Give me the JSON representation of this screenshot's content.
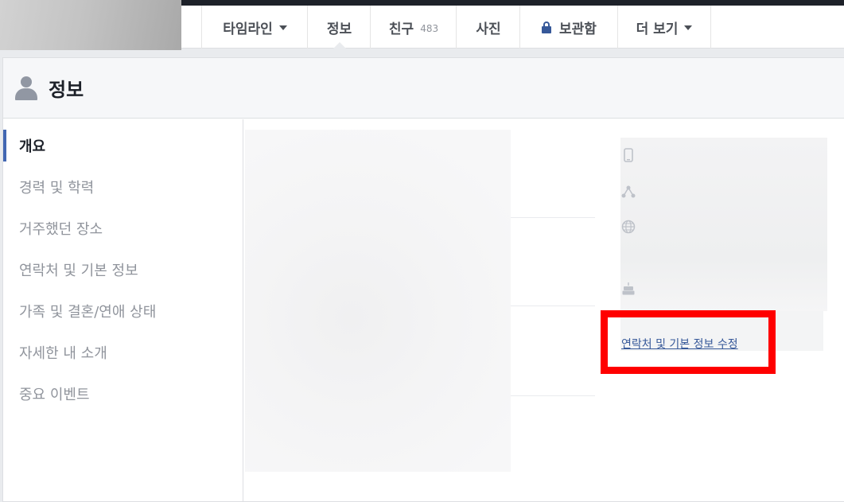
{
  "tabs": [
    {
      "label": "타임라인",
      "dropdown": true
    },
    {
      "label": "정보"
    },
    {
      "label": "친구",
      "count": "483"
    },
    {
      "label": "사진"
    },
    {
      "label": "보관함",
      "icon": "lock-icon"
    },
    {
      "label": "더 보기",
      "dropdown": true
    }
  ],
  "section": {
    "title": "정보",
    "icon": "person-icon"
  },
  "sidebar": {
    "items": [
      {
        "label": "개요",
        "active": true
      },
      {
        "label": "경력 및 학력"
      },
      {
        "label": "거주했던 장소"
      },
      {
        "label": "연락처 및 기본 정보"
      },
      {
        "label": "가족 및 결혼/연애 상태"
      },
      {
        "label": "자세한 내 소개"
      },
      {
        "label": "중요 이벤트"
      }
    ]
  },
  "contact": {
    "icons": [
      "mobile-phone-icon",
      "network-icon",
      "globe-icon",
      "birthday-cake-icon"
    ],
    "edit_link": "연락처 및 기본 정보 수정"
  },
  "colors": {
    "accent": "#4267b2",
    "link": "#365899",
    "highlight": "#ff0000"
  }
}
